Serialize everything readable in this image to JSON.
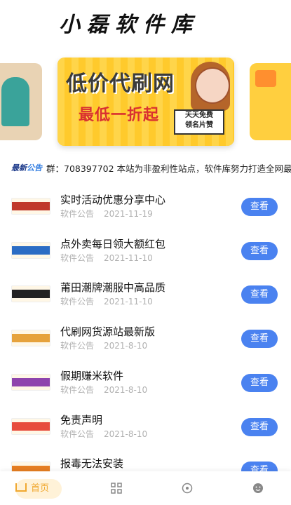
{
  "header": {
    "title": "小磊软件库"
  },
  "banner": {
    "main_title": "低价代刷网",
    "main_subtitle": "最低一折起",
    "main_badge_line1": "天天免费",
    "main_badge_line2": "领名片赞"
  },
  "notice": {
    "logo_a": "最新",
    "logo_b": "公告",
    "text": "群：708397702 本站为非盈利性站点，软件库努力打造全网最优"
  },
  "list": [
    {
      "title": "实时活动优惠分享中心",
      "category": "软件公告",
      "date": "2021-11-19",
      "button": "查看",
      "thumb_color": "#c0392b"
    },
    {
      "title": "点外卖每日领大额红包",
      "category": "软件公告",
      "date": "2021-11-10",
      "button": "查看",
      "thumb_color": "#2b6cc4"
    },
    {
      "title": "莆田潮牌潮服中高品质",
      "category": "软件公告",
      "date": "2021-11-10",
      "button": "查看",
      "thumb_color": "#222222"
    },
    {
      "title": "代刷网货源站最新版",
      "category": "软件公告",
      "date": "2021-8-10",
      "button": "查看",
      "thumb_color": "#e6a23c"
    },
    {
      "title": "假期赚米软件",
      "category": "软件公告",
      "date": "2021-8-10",
      "button": "查看",
      "thumb_color": "#8e44ad"
    },
    {
      "title": "免责声明",
      "category": "软件公告",
      "date": "2021-8-10",
      "button": "查看",
      "thumb_color": "#e74c3c"
    },
    {
      "title": "报毒无法安装",
      "category": "软件公告",
      "date": "",
      "button": "查看",
      "thumb_color": "#e67e22"
    }
  ],
  "tabbar": {
    "home_label": "首页",
    "home_icon": "home-icon",
    "grid_icon": "grid-icon",
    "discover_icon": "compass-icon",
    "profile_icon": "smile-icon"
  },
  "colors": {
    "accent": "#4a82f0",
    "home_active": "#f0a830"
  }
}
